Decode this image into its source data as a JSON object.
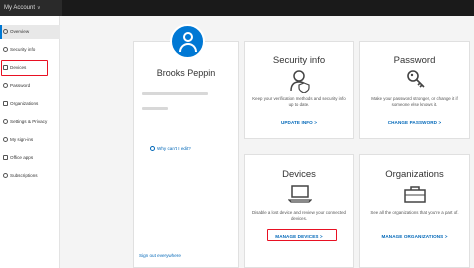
{
  "header": {
    "title": "My Account"
  },
  "sidebar": {
    "items": [
      {
        "label": "Overview",
        "icon": "person-icon"
      },
      {
        "label": "Security info",
        "icon": "security-icon"
      },
      {
        "label": "Devices",
        "icon": "laptop-icon"
      },
      {
        "label": "Password",
        "icon": "key-icon"
      },
      {
        "label": "Organizations",
        "icon": "briefcase-icon"
      },
      {
        "label": "Settings & Privacy",
        "icon": "gear-icon"
      },
      {
        "label": "My sign-ins",
        "icon": "key-icon"
      },
      {
        "label": "Office apps",
        "icon": "apps-icon"
      },
      {
        "label": "Subscriptions",
        "icon": "key-icon"
      }
    ],
    "active_index": 0
  },
  "profile": {
    "name": "Brooks Peppin",
    "why_link": "Why can't I edit?",
    "sign_out": "Sign out everywhere"
  },
  "cards": {
    "security": {
      "title": "Security info",
      "description": "Keep your verification methods and security info up to date.",
      "link": "UPDATE INFO",
      "link_arrow": ">"
    },
    "password": {
      "title": "Password",
      "description": "Make your password stronger, or change it if someone else knows it.",
      "link": "CHANGE PASSWORD",
      "link_arrow": ">"
    },
    "devices": {
      "title": "Devices",
      "description": "Disable a lost device and review your connected devices.",
      "link": "MANAGE DEVICES",
      "link_arrow": ">"
    },
    "organizations": {
      "title": "Organizations",
      "description": "See all the organizations that you're a part of.",
      "link": "MANAGE ORGANIZATIONS",
      "link_arrow": ">"
    }
  },
  "colors": {
    "accent": "#0078d4",
    "link": "#0067b8",
    "highlight": "#e81123",
    "header_bg": "#1a1a1a"
  }
}
